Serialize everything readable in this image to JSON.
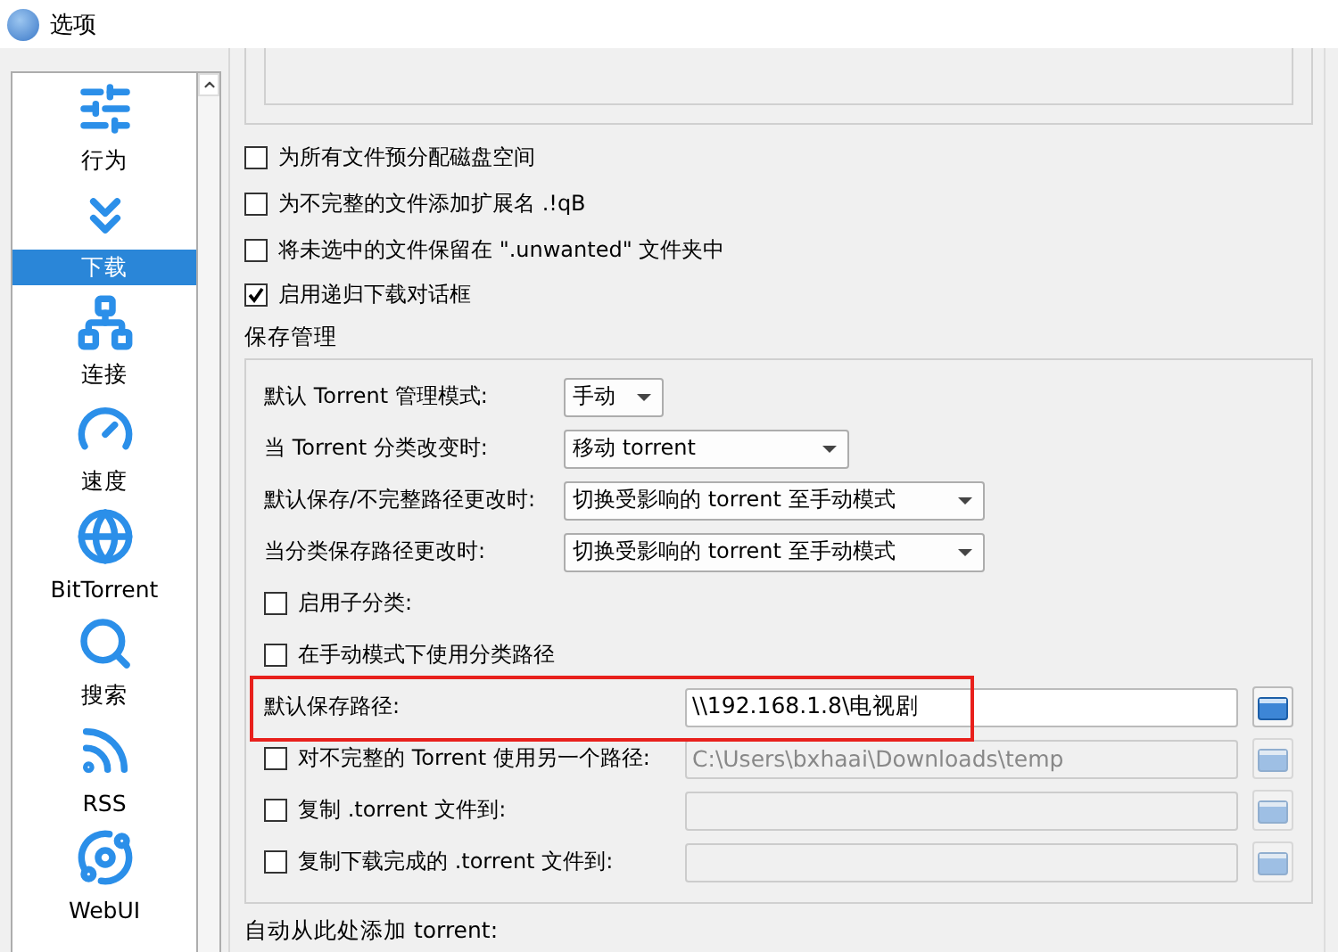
{
  "window": {
    "title": "选项"
  },
  "sidebar": {
    "items": [
      {
        "label": "行为",
        "selected": false
      },
      {
        "label": "下载",
        "selected": true
      },
      {
        "label": "连接",
        "selected": false
      },
      {
        "label": "速度",
        "selected": false
      },
      {
        "label": "BitTorrent",
        "selected": false
      },
      {
        "label": "搜索",
        "selected": false
      },
      {
        "label": "RSS",
        "selected": false
      },
      {
        "label": "WebUI",
        "selected": false
      }
    ]
  },
  "options": [
    {
      "label": "为所有文件预分配磁盘空间",
      "checked": false
    },
    {
      "label": "为不完整的文件添加扩展名 .!qB",
      "checked": false
    },
    {
      "label": "将未选中的文件保留在 \".unwanted\" 文件夹中",
      "checked": false
    },
    {
      "label": "启用递归下载对话框",
      "checked": true
    }
  ],
  "save_management": {
    "title": "保存管理",
    "combos": [
      {
        "label": "默认 Torrent 管理模式:",
        "value": "手动"
      },
      {
        "label": "当 Torrent 分类改变时:",
        "value": "移动 torrent"
      },
      {
        "label": "默认保存/不完整路径更改时:",
        "value": "切换受影响的 torrent 至手动模式"
      },
      {
        "label": "当分类保存路径更改时:",
        "value": "切换受影响的 torrent 至手动模式"
      }
    ],
    "checks": [
      {
        "label": "启用子分类:",
        "checked": false
      },
      {
        "label": "在手动模式下使用分类路径",
        "checked": false
      }
    ],
    "default_path": {
      "label": "默认保存路径:",
      "value": "\\\\192.168.1.8\\电视剧",
      "highlighted": true
    },
    "paths": [
      {
        "label": "对不完整的 Torrent 使用另一个路径:",
        "checked": false,
        "disabled": true,
        "value": "C:\\Users\\bxhaai\\Downloads\\temp"
      },
      {
        "label": "复制 .torrent 文件到:",
        "checked": false,
        "disabled": true
      },
      {
        "label": "复制下载完成的 .torrent 文件到:",
        "checked": false,
        "disabled": true
      }
    ]
  },
  "next_section": {
    "title": "自动从此处添加 torrent:"
  }
}
